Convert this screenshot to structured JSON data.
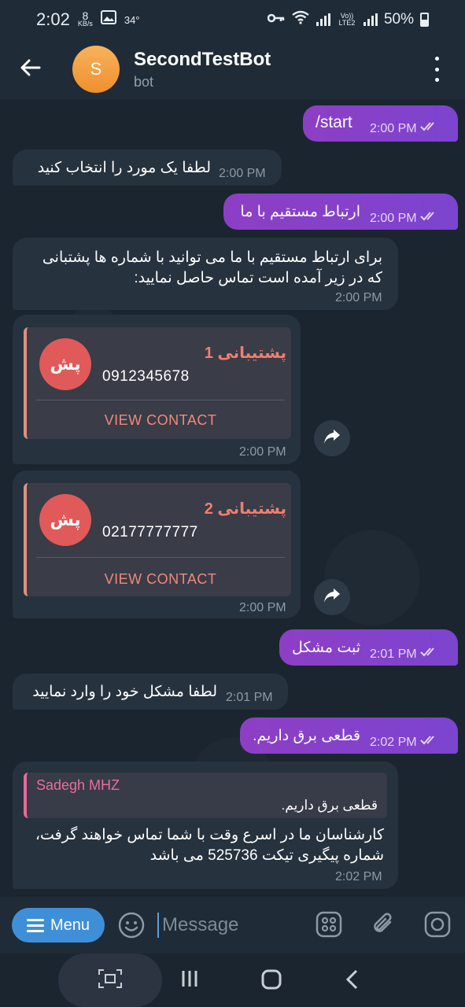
{
  "status_bar": {
    "time": "2:02",
    "net_speed": "8",
    "net_unit": "KB/s",
    "temperature": "34°",
    "volte": "Vo)) LTE2",
    "battery": "50%"
  },
  "header": {
    "title": "SecondTestBot",
    "subtitle": "bot",
    "avatar_letter": "S",
    "avatar_color": "#f3a042"
  },
  "messages": [
    {
      "dir": "out",
      "text": "/start",
      "time": "2:00 PM"
    },
    {
      "dir": "in",
      "text": "لطفا یک مورد را انتخاب کنید",
      "time": "2:00 PM"
    },
    {
      "dir": "out",
      "text": "ارتباط مستقیم با ما",
      "time": "2:00 PM"
    },
    {
      "dir": "in",
      "lines": [
        "برای ارتباط مستقیم با ما می توانید با شماره ها پشتبانی",
        "که در زیر آمده است تماس حاصل نمایید:"
      ],
      "time": "2:00 PM"
    },
    {
      "dir": "in",
      "contact": {
        "initials": "پش",
        "name": "پشتیبانی 1",
        "phone": "0912345678",
        "button": "VIEW CONTACT"
      },
      "time": "2:00 PM"
    },
    {
      "dir": "in",
      "contact": {
        "initials": "پش",
        "name": "پشتیبانی 2",
        "phone": "02177777777",
        "button": "VIEW CONTACT"
      },
      "time": "2:00 PM"
    },
    {
      "dir": "out",
      "text": "ثبت مشکل",
      "time": "2:01 PM"
    },
    {
      "dir": "in",
      "text": "لطفا مشکل خود را وارد نمایید",
      "time": "2:01 PM"
    },
    {
      "dir": "out",
      "text": "قطعی برق داریم.",
      "time": "2:02 PM"
    },
    {
      "dir": "in",
      "reply": {
        "name": "Sadegh MHZ",
        "text": "قطعی برق داریم."
      },
      "lines": [
        "کارشناسان ما در اسرع وقت با شما تماس خواهند گرفت،",
        "شماره پیگیری تیکت 525736 می باشد"
      ],
      "time": "2:02 PM"
    }
  ],
  "input_bar": {
    "menu_label": "Menu",
    "placeholder": "Message",
    "menu_color": "#3f8fd8"
  },
  "colors": {
    "outgoing_bubble": "#8a3fc0",
    "incoming_bubble": "#26323e",
    "background": "#1b2530",
    "contact_accent": "#ef8a7a"
  }
}
